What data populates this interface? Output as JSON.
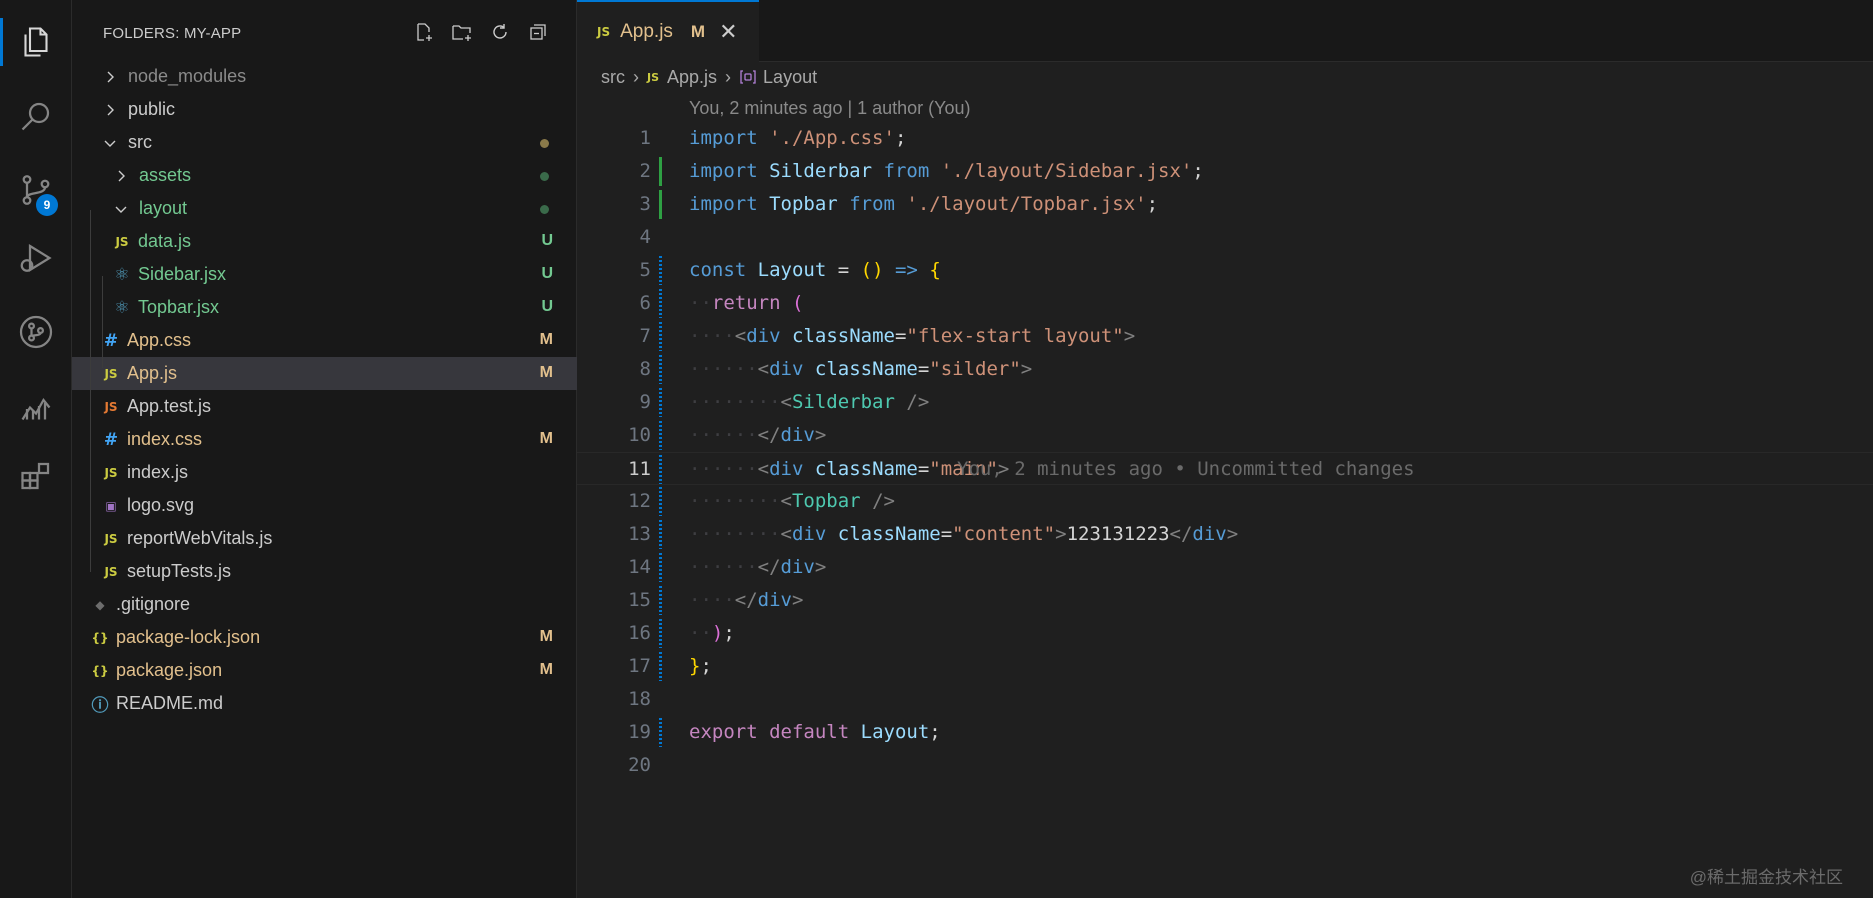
{
  "explorer": {
    "title": "FOLDERS: MY-APP",
    "actions": [
      "new-file-icon",
      "new-folder-icon",
      "refresh-icon",
      "collapse-all-icon"
    ],
    "items": [
      {
        "label": "node_modules",
        "type": "folder",
        "open": false,
        "depth": 0,
        "color": "#8b8b8b"
      },
      {
        "label": "public",
        "type": "folder",
        "open": false,
        "depth": 0,
        "color": "#cccccc"
      },
      {
        "label": "src",
        "type": "folder",
        "open": true,
        "depth": 0,
        "color": "#cccccc",
        "dot": "#8a7a4a"
      },
      {
        "label": "assets",
        "type": "folder",
        "open": false,
        "depth": 1,
        "color": "#73c991",
        "dot": "#3a6a4a"
      },
      {
        "label": "layout",
        "type": "folder",
        "open": true,
        "depth": 1,
        "color": "#73c991",
        "dot": "#3a6a4a"
      },
      {
        "label": "data.js",
        "type": "js",
        "depth": 2,
        "color": "#73c991",
        "status": "U",
        "statusColor": "#73c991"
      },
      {
        "label": "Sidebar.jsx",
        "type": "react",
        "depth": 2,
        "color": "#73c991",
        "status": "U",
        "statusColor": "#73c991"
      },
      {
        "label": "Topbar.jsx",
        "type": "react",
        "depth": 2,
        "color": "#73c991",
        "status": "U",
        "statusColor": "#73c991"
      },
      {
        "label": "App.css",
        "type": "css",
        "depth": 1,
        "color": "#e2c08d",
        "status": "M",
        "statusColor": "#e2c08d"
      },
      {
        "label": "App.js",
        "type": "js",
        "depth": 1,
        "color": "#e2c08d",
        "status": "M",
        "statusColor": "#e2c08d",
        "selected": true
      },
      {
        "label": "App.test.js",
        "type": "jstest",
        "depth": 1,
        "color": "#cccccc"
      },
      {
        "label": "index.css",
        "type": "css",
        "depth": 1,
        "color": "#e2c08d",
        "status": "M",
        "statusColor": "#e2c08d"
      },
      {
        "label": "index.js",
        "type": "js",
        "depth": 1,
        "color": "#cccccc"
      },
      {
        "label": "logo.svg",
        "type": "svg",
        "depth": 1,
        "color": "#cccccc"
      },
      {
        "label": "reportWebVitals.js",
        "type": "js",
        "depth": 1,
        "color": "#cccccc"
      },
      {
        "label": "setupTests.js",
        "type": "js",
        "depth": 1,
        "color": "#cccccc"
      },
      {
        "label": ".gitignore",
        "type": "git",
        "depth": 0,
        "color": "#cccccc"
      },
      {
        "label": "package-lock.json",
        "type": "json",
        "depth": 0,
        "color": "#e2c08d",
        "status": "M",
        "statusColor": "#e2c08d"
      },
      {
        "label": "package.json",
        "type": "json",
        "depth": 0,
        "color": "#e2c08d",
        "status": "M",
        "statusColor": "#e2c08d"
      },
      {
        "label": "README.md",
        "type": "info",
        "depth": 0,
        "color": "#cccccc"
      }
    ]
  },
  "activity": {
    "items": [
      "explorer-icon",
      "search-icon",
      "source-control-icon",
      "run-debug-icon",
      "git-graph-icon",
      "analytics-icon",
      "extensions-icon"
    ],
    "source_control_badge": "9"
  },
  "tab": {
    "icon": "JS",
    "name": "App.js",
    "modified": "M",
    "close": "✕"
  },
  "breadcrumb": {
    "folder": "src",
    "file_icon": "JS",
    "file": "App.js",
    "symbol": "Layout"
  },
  "blame": "You, 2 minutes ago | 1 author (You)",
  "inline_blame": "You, 2 minutes ago • Uncommitted changes",
  "code": {
    "current_line": 11,
    "lines": [
      {
        "n": "1",
        "gutter": "none"
      },
      {
        "n": "2",
        "gutter": "add"
      },
      {
        "n": "3",
        "gutter": "add"
      },
      {
        "n": "4",
        "gutter": "none"
      },
      {
        "n": "5",
        "gutter": "mod"
      },
      {
        "n": "6",
        "gutter": "mod"
      },
      {
        "n": "7",
        "gutter": "mod"
      },
      {
        "n": "8",
        "gutter": "mod"
      },
      {
        "n": "9",
        "gutter": "mod"
      },
      {
        "n": "10",
        "gutter": "mod"
      },
      {
        "n": "11",
        "gutter": "mod"
      },
      {
        "n": "12",
        "gutter": "mod"
      },
      {
        "n": "13",
        "gutter": "mod"
      },
      {
        "n": "14",
        "gutter": "mod"
      },
      {
        "n": "15",
        "gutter": "mod"
      },
      {
        "n": "16",
        "gutter": "mod"
      },
      {
        "n": "17",
        "gutter": "mod"
      },
      {
        "n": "18",
        "gutter": "none"
      },
      {
        "n": "19",
        "gutter": "mod"
      },
      {
        "n": "20",
        "gutter": "none"
      }
    ],
    "text": [
      [
        [
          "k",
          "import"
        ],
        [
          "d",
          " "
        ],
        [
          "s",
          "'./App.css'"
        ],
        [
          "d",
          ";"
        ]
      ],
      [
        [
          "k",
          "import"
        ],
        [
          "d",
          " "
        ],
        [
          "v",
          "Silderbar"
        ],
        [
          "d",
          " "
        ],
        [
          "k",
          "from"
        ],
        [
          "d",
          " "
        ],
        [
          "s",
          "'./layout/Sidebar.jsx'"
        ],
        [
          "d",
          ";"
        ]
      ],
      [
        [
          "k",
          "import"
        ],
        [
          "d",
          " "
        ],
        [
          "v",
          "Topbar"
        ],
        [
          "d",
          " "
        ],
        [
          "k",
          "from"
        ],
        [
          "d",
          " "
        ],
        [
          "s",
          "'./layout/Topbar.jsx'"
        ],
        [
          "d",
          ";"
        ]
      ],
      [],
      [
        [
          "k",
          "const"
        ],
        [
          "d",
          " "
        ],
        [
          "v",
          "Layout"
        ],
        [
          "d",
          " = "
        ],
        [
          "y",
          "()"
        ],
        [
          "d",
          " "
        ],
        [
          "k",
          "=>"
        ],
        [
          "d",
          " "
        ],
        [
          "y",
          "{"
        ]
      ],
      [
        [
          "ws",
          "··"
        ],
        [
          "kw",
          "return"
        ],
        [
          "d",
          " "
        ],
        [
          "p",
          "("
        ]
      ],
      [
        [
          "ws",
          "····"
        ],
        [
          "t",
          "<"
        ],
        [
          "k",
          "div"
        ],
        [
          "d",
          " "
        ],
        [
          "v",
          "className"
        ],
        [
          "d",
          "="
        ],
        [
          "s",
          "\"flex-start layout\""
        ],
        [
          "t",
          ">"
        ]
      ],
      [
        [
          "ws",
          "······"
        ],
        [
          "t",
          "<"
        ],
        [
          "k",
          "div"
        ],
        [
          "d",
          " "
        ],
        [
          "v",
          "className"
        ],
        [
          "d",
          "="
        ],
        [
          "s",
          "\"silder\""
        ],
        [
          "t",
          ">"
        ]
      ],
      [
        [
          "ws",
          "········"
        ],
        [
          "t",
          "<"
        ],
        [
          "c",
          "Silderbar"
        ],
        [
          "d",
          " "
        ],
        [
          "t",
          "/>"
        ]
      ],
      [
        [
          "ws",
          "······"
        ],
        [
          "t",
          "</"
        ],
        [
          "k",
          "div"
        ],
        [
          "t",
          ">"
        ]
      ],
      [
        [
          "ws",
          "······"
        ],
        [
          "t",
          "<"
        ],
        [
          "k",
          "div"
        ],
        [
          "d",
          " "
        ],
        [
          "v",
          "className"
        ],
        [
          "d",
          "="
        ],
        [
          "s",
          "\"main\""
        ],
        [
          "t",
          ">"
        ]
      ],
      [
        [
          "ws",
          "········"
        ],
        [
          "t",
          "<"
        ],
        [
          "c",
          "Topbar"
        ],
        [
          "d",
          " "
        ],
        [
          "t",
          "/>"
        ]
      ],
      [
        [
          "ws",
          "········"
        ],
        [
          "t",
          "<"
        ],
        [
          "k",
          "div"
        ],
        [
          "d",
          " "
        ],
        [
          "v",
          "className"
        ],
        [
          "d",
          "="
        ],
        [
          "s",
          "\"content\""
        ],
        [
          "t",
          ">"
        ],
        [
          "d",
          "123131223"
        ],
        [
          "t",
          "</"
        ],
        [
          "k",
          "div"
        ],
        [
          "t",
          ">"
        ]
      ],
      [
        [
          "ws",
          "······"
        ],
        [
          "t",
          "</"
        ],
        [
          "k",
          "div"
        ],
        [
          "t",
          ">"
        ]
      ],
      [
        [
          "ws",
          "····"
        ],
        [
          "t",
          "</"
        ],
        [
          "k",
          "div"
        ],
        [
          "t",
          ">"
        ]
      ],
      [
        [
          "ws",
          "··"
        ],
        [
          "p",
          ")"
        ],
        [
          "d",
          ";"
        ]
      ],
      [
        [
          "y",
          "}"
        ],
        [
          "d",
          ";"
        ]
      ],
      [],
      [
        [
          "kw",
          "export"
        ],
        [
          "d",
          " "
        ],
        [
          "kw",
          "default"
        ],
        [
          "d",
          " "
        ],
        [
          "v",
          "Layout"
        ],
        [
          "d",
          ";"
        ]
      ],
      []
    ]
  },
  "colors": {
    "accent": "#0078d4",
    "modified": "#e2c08d",
    "untracked": "#73c991"
  },
  "watermark": "@稀土掘金技术社区"
}
